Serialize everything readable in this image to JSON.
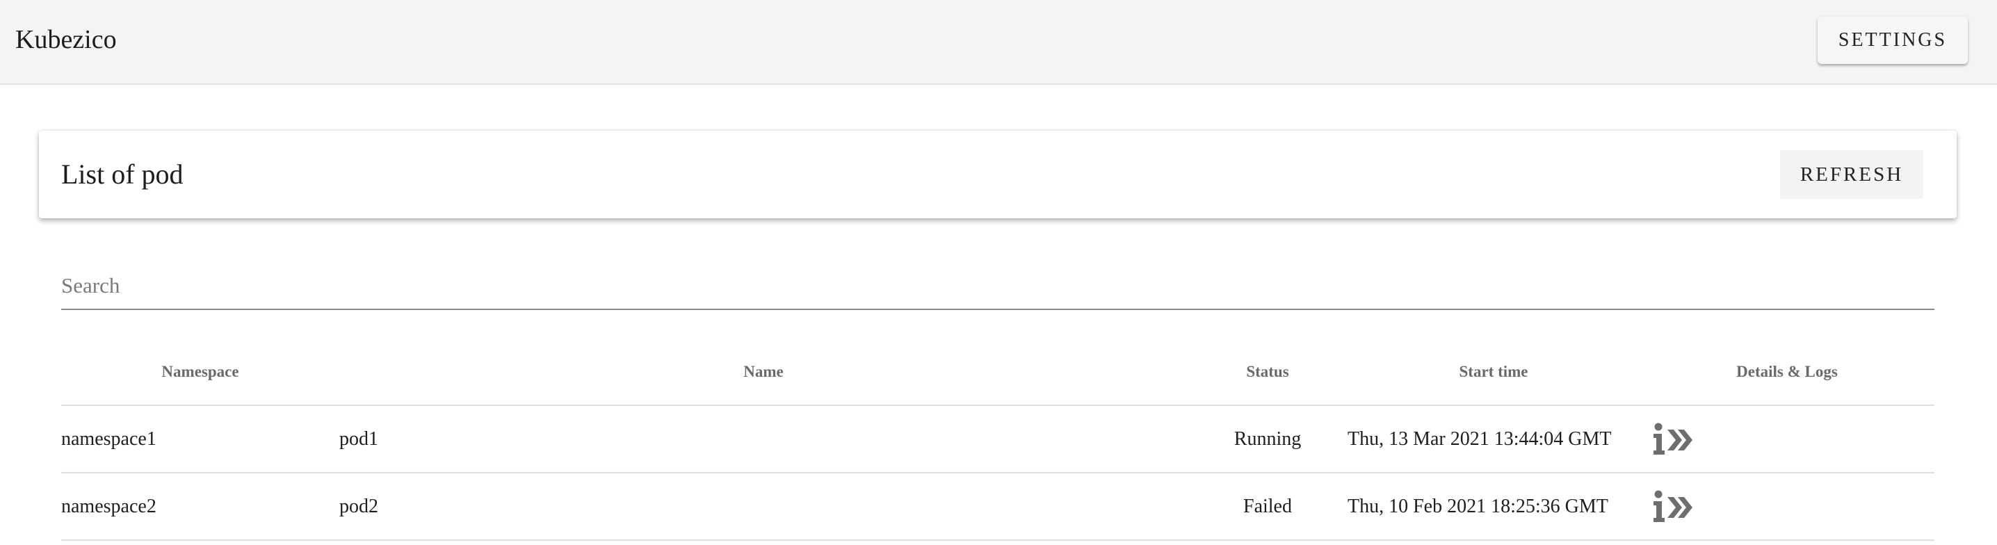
{
  "app": {
    "title": "Kubezico",
    "settings_label": "SETTINGS"
  },
  "card": {
    "title": "List of pod",
    "refresh_label": "REFRESH"
  },
  "search": {
    "placeholder": "Search",
    "value": ""
  },
  "table": {
    "headers": {
      "namespace": "Namespace",
      "name": "Name",
      "status": "Status",
      "start_time": "Start time",
      "details": "Details & Logs"
    },
    "rows": [
      {
        "namespace": "namespace1",
        "name": "pod1",
        "status": "Running",
        "start_time": "Thu, 13 Mar 2021 13:44:04 GMT",
        "details_icon": "info-arrows-icon"
      },
      {
        "namespace": "namespace2",
        "name": "pod2",
        "status": "Failed",
        "start_time": "Thu, 10 Feb 2021 18:25:36 GMT",
        "details_icon": "info-arrows-icon"
      }
    ]
  },
  "colors": {
    "appbar_bg": "#f4f4f4",
    "icon": "#6e6e6e",
    "divider": "#e0e0e0"
  }
}
